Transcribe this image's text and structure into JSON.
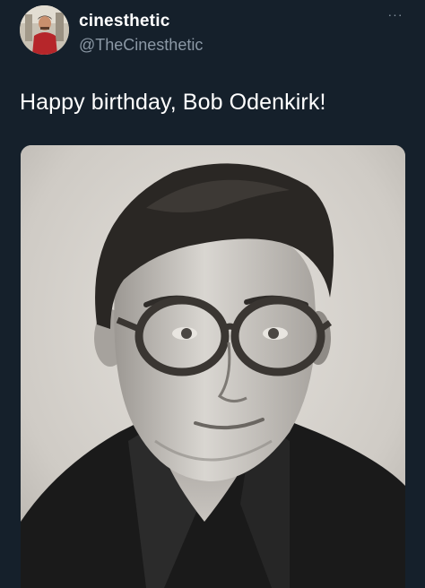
{
  "tweet": {
    "display_name": "cinesthetic",
    "handle": "@TheCinesthetic",
    "more_icon": "more-horizontal-icon",
    "more_glyph": "···",
    "text": "Happy birthday, Bob Odenkirk!"
  },
  "colors": {
    "background": "#15202b",
    "primary_text": "#ffffff",
    "secondary_text": "#8b98a5"
  },
  "media": {
    "type": "black-and-white portrait photograph"
  }
}
